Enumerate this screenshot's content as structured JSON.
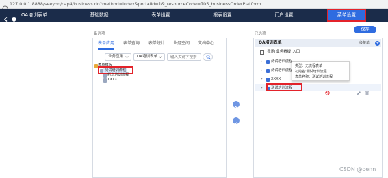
{
  "browser": {
    "url": "127.0.0.1:8888/seeyon/cap4/business.do?method=index&portalId=1&_resourceCode=T05_businessOrderPlatform"
  },
  "nav": {
    "app_title": "OA培训表单",
    "tabs": [
      "基础数据",
      "表单设置",
      "报表设置",
      "门户设置",
      "菜单设置"
    ],
    "active_tab": "菜单设置"
  },
  "toolbar": {
    "save_label": "保存"
  },
  "left": {
    "section_label": "备选项",
    "tabs": [
      "表单应用",
      "表单查询",
      "表单统计",
      "业务空间",
      "文档中心"
    ],
    "filter_type": "业务应用",
    "filter_form": "OA培训表单",
    "search_placeholder": "输入关键字搜索",
    "tree": {
      "root": "表单模板",
      "items": [
        "测试培训流程",
        "新增培训流程",
        "XXXX"
      ]
    }
  },
  "right": {
    "section_label": "已选项",
    "header_title": "OA培训表单",
    "header_link": "一级菜单",
    "checkbox_label": "显示[业务看板]入口",
    "items": [
      "测试培训流程",
      "测试培训流程",
      "XXXX",
      "测试培训流程"
    ]
  },
  "tooltip": {
    "line1": "类型：无流程表单",
    "line2": "初始名:测试培训流程",
    "line3": "表单名称：测试培训流程"
  },
  "watermark": "CSDN @oenn",
  "colors": {
    "nav_bg": "#1b2c4a",
    "accent": "#2f6ce0",
    "highlight": "#e3232b"
  }
}
